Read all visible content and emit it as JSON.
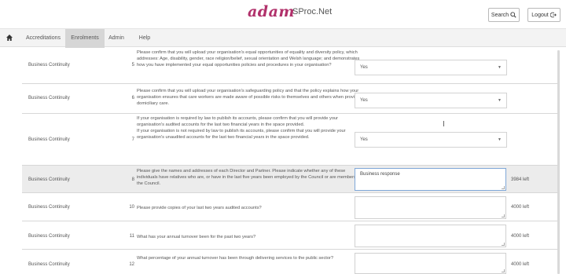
{
  "header": {
    "logo": "adam",
    "product": "SProc.Net",
    "search_label": "Search",
    "logout_label": "Logout"
  },
  "nav": {
    "items": [
      "Accreditations",
      "Enrolments",
      "Admin",
      "Help"
    ],
    "active": "Enrolments"
  },
  "rows": [
    {
      "category": "Business Continuity",
      "number": "5",
      "question": "Please confirm that you will upload your organisation's equal opportunities of equality and diversity policy, which addresses: Age, disability, gender, race religion/belief, sexual orientation and Welsh language; and demonstrates how you have implemented your equal opportunities policies and procedures in your organisation?",
      "answer": "Yes"
    },
    {
      "category": "Business Continuity",
      "number": "6",
      "question": "Please confirm that you will upload your organisation's safeguarding policy and that the policy explains how your organisation ensures that care workers are made aware of possible risks to themselves and others when providing domiciliary care.",
      "answer": "Yes"
    },
    {
      "category": "Business Continuity",
      "number": "7",
      "question_lines": [
        "If your organisation is required by law to publish its accounts, please confirm that you will provide your organisation's audited accounts for the last two financial years in the space provided.",
        "If your organisation is not required by law to publish its accounts, please confirm that you will provide your organisation's unaudited accounts for the last two financial years in the space provided."
      ],
      "answer": "Yes"
    },
    {
      "category": "Business Continuity",
      "number": "8",
      "question": "Please give the names and addresses of each Director and Partner. Please indicate whether any of these individuals have relatives who are, or have in the last five years been employed by the Council or are members of the Council.",
      "answer": "Business response",
      "chars_left": "3984 left"
    },
    {
      "category": "Business Continuity",
      "number": "10",
      "question": "Please provide copies of your last two years audited accounts?",
      "answer": "",
      "chars_left": "4000 left"
    },
    {
      "category": "Business Continuity",
      "number": "11",
      "question": "What has your annual turnover been for the past two years?",
      "answer": "",
      "chars_left": "4000 left"
    },
    {
      "category": "Business Continuity",
      "number": "12",
      "question": "What percentage of your annual turnover has been through delivering services to the public sector?",
      "answer": "",
      "chars_left": "4000 left"
    }
  ],
  "icons": {
    "home": "home-icon",
    "search": "search-icon",
    "logout": "logout-icon",
    "dropdown": "chevron-down-icon"
  },
  "colors": {
    "brand": "#b1316b",
    "active_tab": "#d6d6d6",
    "highlight_row": "#ececec",
    "focus_border": "#7fa7d8"
  }
}
